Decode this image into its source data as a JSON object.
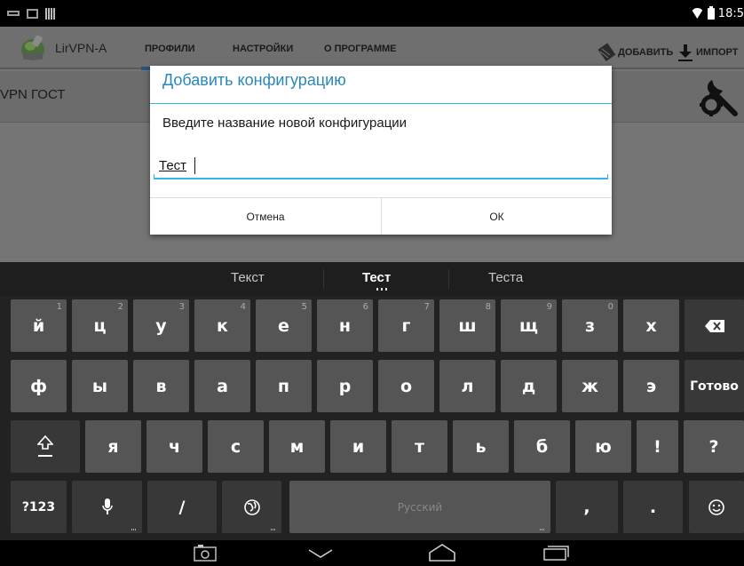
{
  "status_bar": {
    "time": "18:5",
    "left_icons": [
      "keyboard-icon",
      "image-icon",
      "signal-bars-icon"
    ],
    "right_icons": [
      "wifi-icon",
      "battery-icon"
    ]
  },
  "action_bar": {
    "app_title": "LirVPN-A",
    "tabs": [
      {
        "label": "ПРОФИЛИ",
        "active": true
      },
      {
        "label": "НАСТРОЙКИ",
        "active": false
      },
      {
        "label": "О ПРОГРАММЕ",
        "active": false
      }
    ],
    "actions": {
      "add_label": "ДОБАВИТЬ",
      "import_label": "ИМПОРТ"
    }
  },
  "profile": {
    "name": "VPN ГОСТ"
  },
  "dialog": {
    "title": "Добавить конфигурацию",
    "message": "Введите название новой конфигурации",
    "input_value": "Тест",
    "cancel_label": "Отмена",
    "ok_label": "ОК",
    "accent_color": "#33b5e5"
  },
  "keyboard": {
    "suggestions": [
      "Текст",
      "Тест",
      "Теста"
    ],
    "row1": [
      {
        "label": "й",
        "hint": "1"
      },
      {
        "label": "ц",
        "hint": "2"
      },
      {
        "label": "у",
        "hint": "3"
      },
      {
        "label": "к",
        "hint": "4"
      },
      {
        "label": "е",
        "hint": "5"
      },
      {
        "label": "н",
        "hint": "6"
      },
      {
        "label": "г",
        "hint": "7"
      },
      {
        "label": "ш",
        "hint": "8"
      },
      {
        "label": "щ",
        "hint": "9"
      },
      {
        "label": "з",
        "hint": "0"
      },
      {
        "label": "х",
        "hint": ""
      }
    ],
    "row2": [
      "ф",
      "ы",
      "в",
      "а",
      "п",
      "р",
      "о",
      "л",
      "д",
      "ж",
      "э"
    ],
    "done_label": "Готово",
    "row3": [
      "я",
      "ч",
      "с",
      "м",
      "и",
      "т",
      "ь",
      "б",
      "ю",
      "!",
      "?"
    ],
    "symbols_label": "?123",
    "slash_label": "/",
    "space_label": "Русский",
    "comma_label": ",",
    "period_label": "."
  }
}
